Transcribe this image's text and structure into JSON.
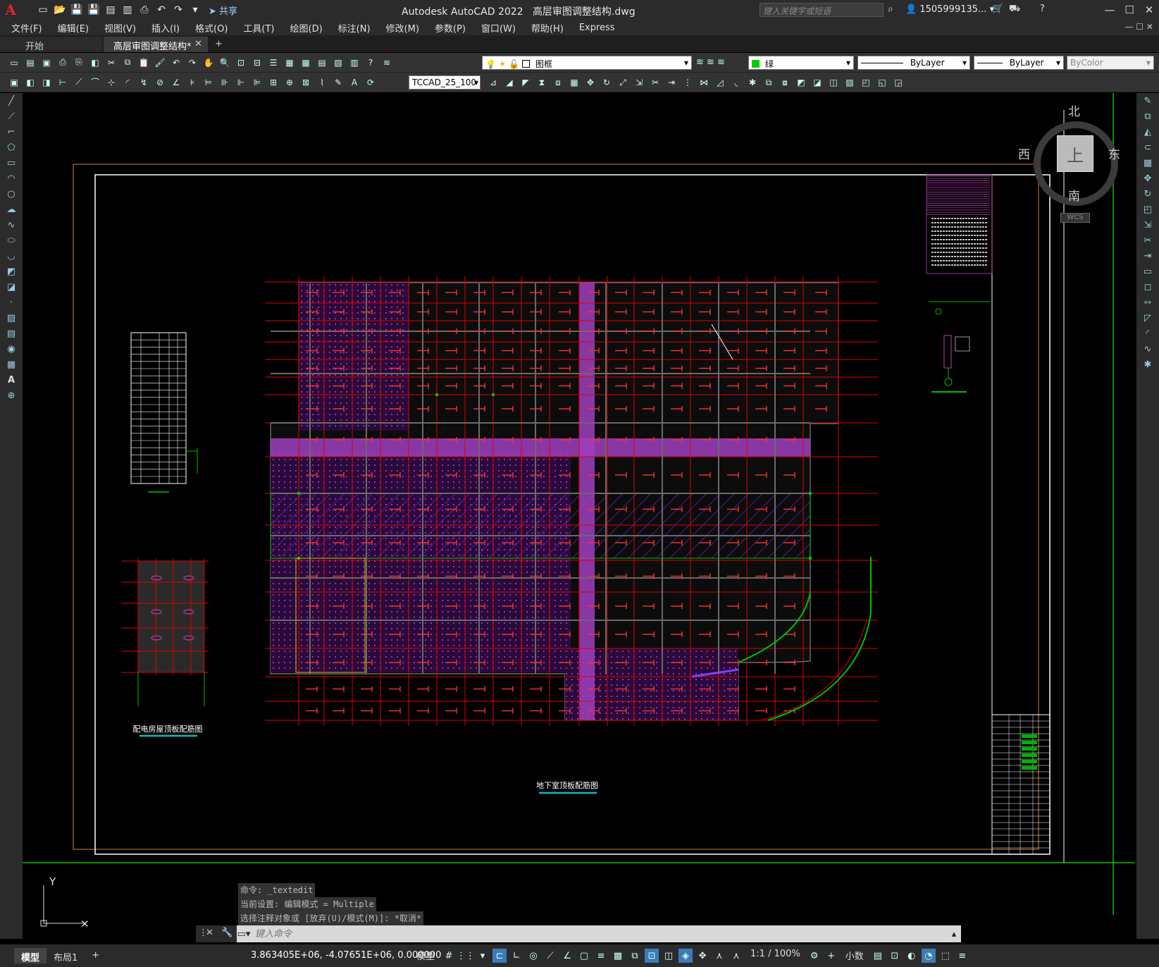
{
  "app": {
    "title": "Autodesk AutoCAD 2022",
    "file_title": "高层审图调整结构.dwg",
    "share_label": "共享",
    "search_placeholder": "键入关键字或短语",
    "user": "1505999135..."
  },
  "menu": [
    "文件(F)",
    "编辑(E)",
    "视图(V)",
    "插入(I)",
    "格式(O)",
    "工具(T)",
    "绘图(D)",
    "标注(N)",
    "修改(M)",
    "参数(P)",
    "窗口(W)",
    "帮助(H)",
    "Express"
  ],
  "file_tabs": {
    "start": "开始",
    "active": "高层审图调整结构*"
  },
  "properties": {
    "layer": "图框",
    "color": "绿",
    "color_hex": "#00cc00",
    "linetype": "ByLayer",
    "lineweight": "ByLayer",
    "plotstyle": "ByColor",
    "dimstyle": "TCCAD_25_100"
  },
  "viewcube": {
    "north": "北",
    "south": "南",
    "east": "东",
    "west": "西",
    "face": "上",
    "wcs": "WCS"
  },
  "drawing": {
    "title_main": "地下室顶板配筋图",
    "title_small": "配电房屋顶板配筋图"
  },
  "command": {
    "history": [
      "命令: _textedit",
      "当前设置: 编辑模式 = Multiple",
      "选择注释对象或 [放弃(U)/模式(M)]: *取消*"
    ],
    "placeholder": "键入命令"
  },
  "ucs": {
    "y": "Y"
  },
  "status": {
    "tab_model": "模型",
    "tab_layout": "布局1",
    "coords": "3.863405E+06, -4.07651E+06, 0.000000",
    "space": "模型",
    "scale": "1:1 / 100%",
    "units": "小数"
  },
  "colors": {
    "frame": "#ffffff",
    "grid": "#e00000",
    "slab": "#a040c0",
    "hatch": "#7020d0",
    "green": "#00c000"
  }
}
